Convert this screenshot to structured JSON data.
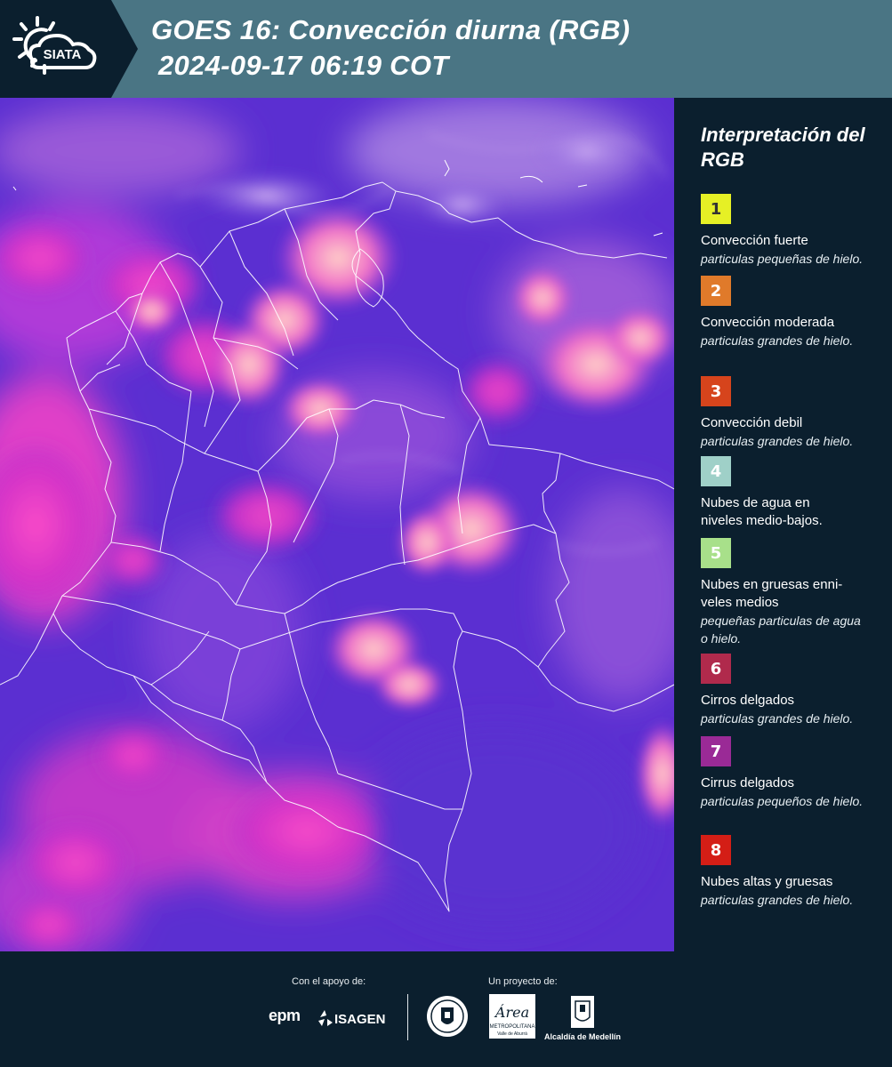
{
  "header": {
    "logo_text": "SIATA",
    "title_line1": "GOES 16: Convección diurna (RGB)",
    "title_line2": "2024-09-17 06:19 COT",
    "background_color": "#4a7584"
  },
  "map": {
    "description_icon": "satellite-rgb-map",
    "base_color": "#6a35d8"
  },
  "legend": {
    "title": "Interpretación del RGB",
    "items": [
      {
        "number": "1",
        "color": "#e6f025",
        "text_color": "#333333",
        "main": "Convección fuerte",
        "sub": "particulas pequeñas de hielo."
      },
      {
        "number": "2",
        "color": "#e07a2a",
        "text_color": "#ffffff",
        "main": "Convección moderada",
        "sub": "particulas grandes de hielo."
      },
      {
        "number": "3",
        "color": "#d6441c",
        "text_color": "#ffffff",
        "main": "Convección debil",
        "sub": "particulas grandes de hielo."
      },
      {
        "number": "4",
        "color": "#9fd0c8",
        "text_color": "#ffffff",
        "main": "Nubes de agua en niveles medio-bajos.",
        "sub": ""
      },
      {
        "number": "5",
        "color": "#a8e08a",
        "text_color": "#ffffff",
        "main": "Nubes en gruesas enni-veles medios",
        "sub": "pequeñas particulas de agua o hielo."
      },
      {
        "number": "6",
        "color": "#b02a4c",
        "text_color": "#ffffff",
        "main": "Cirros delgados",
        "sub": "particulas grandes de hielo."
      },
      {
        "number": "7",
        "color": "#9a2a96",
        "text_color": "#ffffff",
        "main": "Cirrus delgados",
        "sub": "particulas pequeños de hielo."
      },
      {
        "number": "8",
        "color": "#d41e16",
        "text_color": "#ffffff",
        "main": "Nubes altas y gruesas",
        "sub": "particulas grandes de hielo."
      }
    ]
  },
  "footer": {
    "support_label": "Con el apoyo de:",
    "project_label": "Un proyecto de:",
    "sponsor_epm": "epm",
    "sponsor_isagen": "ISAGEN",
    "area_text": "Área",
    "area_sub": "METROPOLITANA",
    "area_sub2": "Valle de Aburrá",
    "alcaldia_label": "Alcaldía de Medellín"
  }
}
